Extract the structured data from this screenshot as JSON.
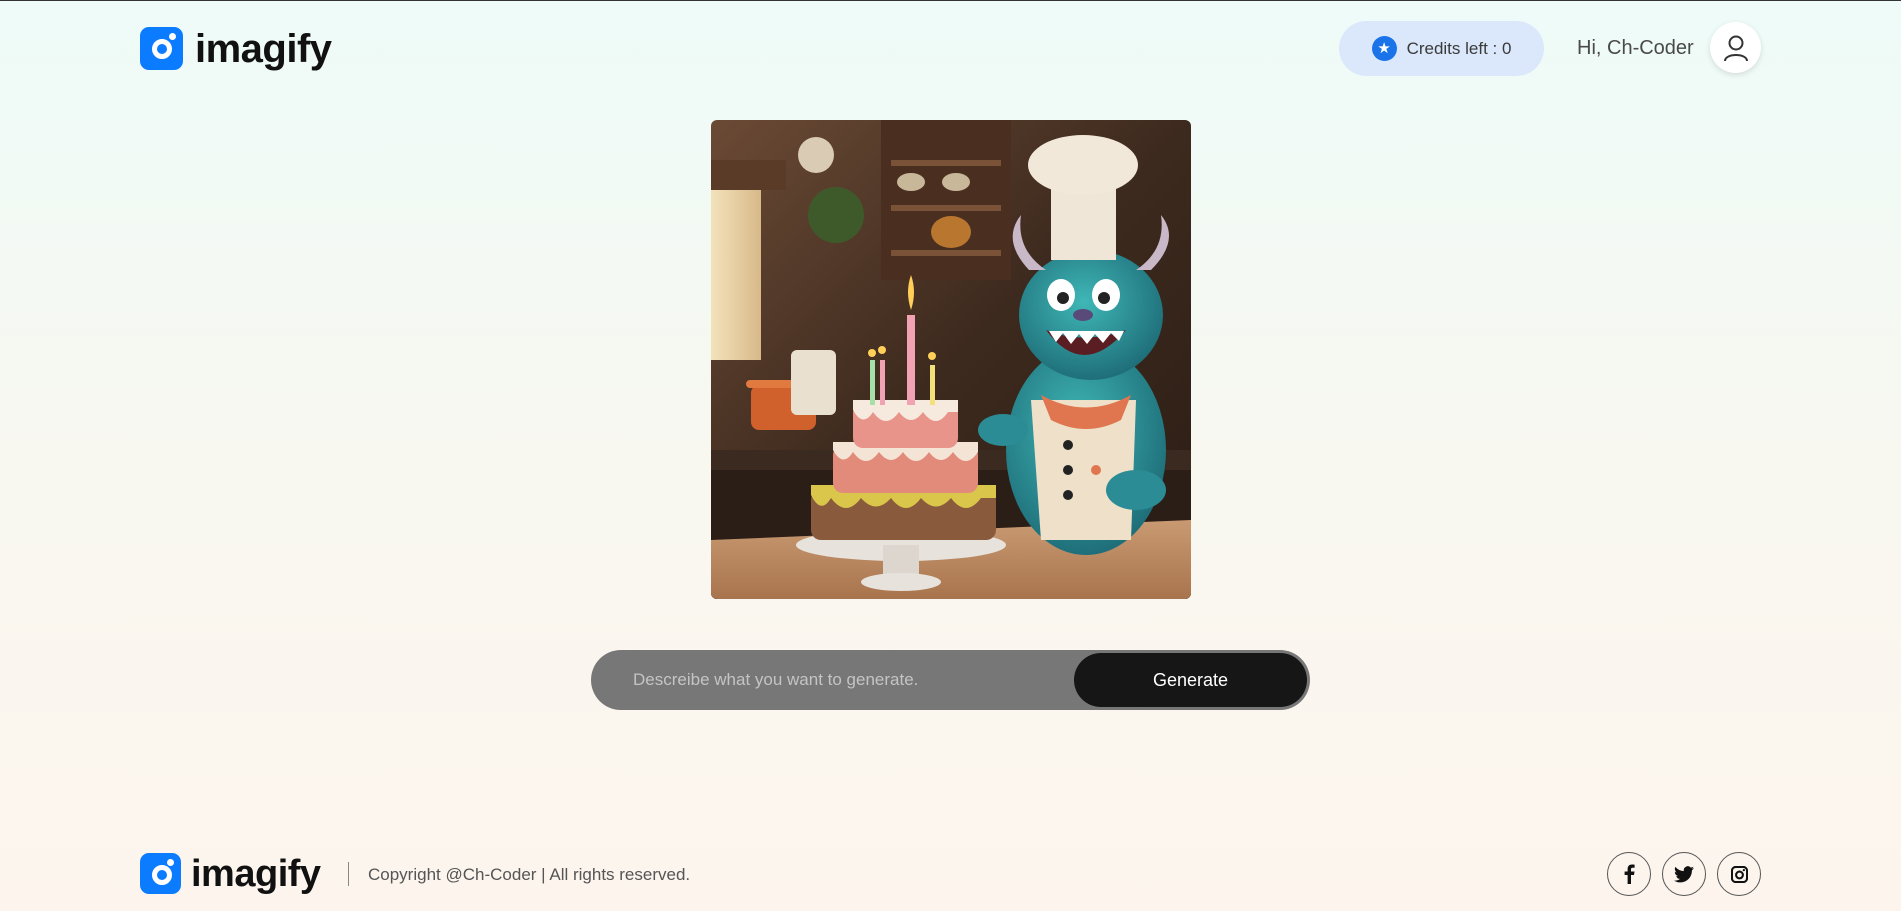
{
  "header": {
    "brand": "imagify",
    "credits_label": "Credits left : 0",
    "greeting": "Hi, Ch-Coder"
  },
  "main": {
    "image_icon": "birthday-cake-monster-chef-illustration",
    "prompt_placeholder": "Descreibe what you want to generate.",
    "prompt_value": "",
    "generate_label": "Generate"
  },
  "footer": {
    "brand": "imagify",
    "copyright": "Copyright @Ch-Coder | All rights reserved.",
    "socials": [
      "facebook-icon",
      "twitter-icon",
      "instagram-icon"
    ]
  },
  "colors": {
    "accent": "#0b7bff",
    "credits_bg": "#dbe8fb",
    "prompt_bg": "#777777",
    "button_bg": "#161616"
  }
}
